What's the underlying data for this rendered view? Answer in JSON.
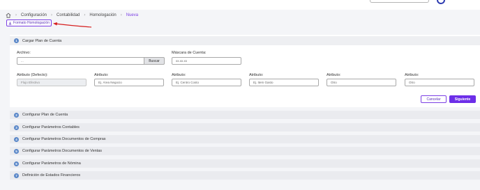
{
  "breadcrumb": {
    "items": [
      "Configuración",
      "Contabilidad",
      "Homologación"
    ],
    "current": "Nueva"
  },
  "format_button": {
    "label": "Formato Homologación"
  },
  "section1": {
    "number": "1",
    "title": "Cargar Plan de Cuenta",
    "archivo_label": "Archivo:",
    "archivo_value": "...",
    "buscar_label": "Buscar",
    "mascara_label": "Máscara de Cuenta:",
    "mascara_value": "xx.xx.xx",
    "attr_default_label": "Atributo (Defecto):",
    "attr_default_value": "Flujo Efectivo",
    "attrs": [
      {
        "label": "Atributo:",
        "value": "Ej. Área Negocio"
      },
      {
        "label": "Atributo:",
        "value": "Ej. Centro Costo"
      },
      {
        "label": "Atributo:",
        "value": "Ej. Item Gasto"
      },
      {
        "label": "Atributo:",
        "value": "Otro"
      },
      {
        "label": "Atributo:",
        "value": "Otro"
      }
    ],
    "cancel_label": "Cancelar",
    "next_label": "Siguiente"
  },
  "accordion": [
    {
      "number": "2",
      "title": "Configurar Plan de Cuenta"
    },
    {
      "number": "3",
      "title": "Configurar Parámetros Contables"
    },
    {
      "number": "4",
      "title": "Configurar Parámetros Documentos de Compras"
    },
    {
      "number": "5",
      "title": "Configurar Parámetros Documentos de Ventas"
    },
    {
      "number": "6",
      "title": "Configurar Parámetros de Nómina"
    },
    {
      "number": "7",
      "title": "Definición de Estados Financieros"
    }
  ],
  "colors": {
    "accent": "#6c2ee8",
    "step": "#5a87c8",
    "arrow": "#d61f1f"
  }
}
